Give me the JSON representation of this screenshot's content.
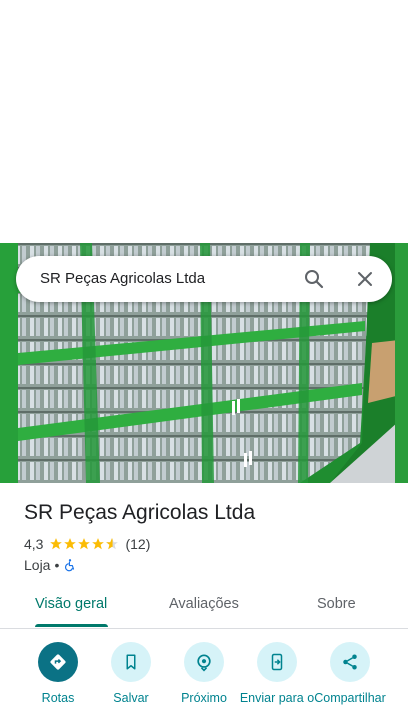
{
  "search": {
    "query": "SR Peças Agricolas Ltda"
  },
  "place": {
    "title": "SR Peças Agricolas Ltda",
    "rating": "4,3",
    "stars": 4.3,
    "reviews": "(12)",
    "category": "Loja",
    "separator": "•"
  },
  "tabs": [
    {
      "label": "Visão geral",
      "active": true
    },
    {
      "label": "Avaliações",
      "active": false
    },
    {
      "label": "Sobre",
      "active": false
    }
  ],
  "actions": [
    {
      "label": "Rotas",
      "icon": "directions-icon"
    },
    {
      "label": "Salvar",
      "icon": "bookmark-icon"
    },
    {
      "label": "Próximo",
      "icon": "nearby-icon"
    },
    {
      "label": "Enviar para o",
      "icon": "send-to-phone-icon"
    },
    {
      "label": "Compartilhar",
      "icon": "share-icon"
    }
  ],
  "colors": {
    "accent": "#00796b",
    "action_bg": "#d6f3f8",
    "primary_action": "#0b7285",
    "star": "#fbbc04",
    "hero_green": "#1f8d30"
  }
}
